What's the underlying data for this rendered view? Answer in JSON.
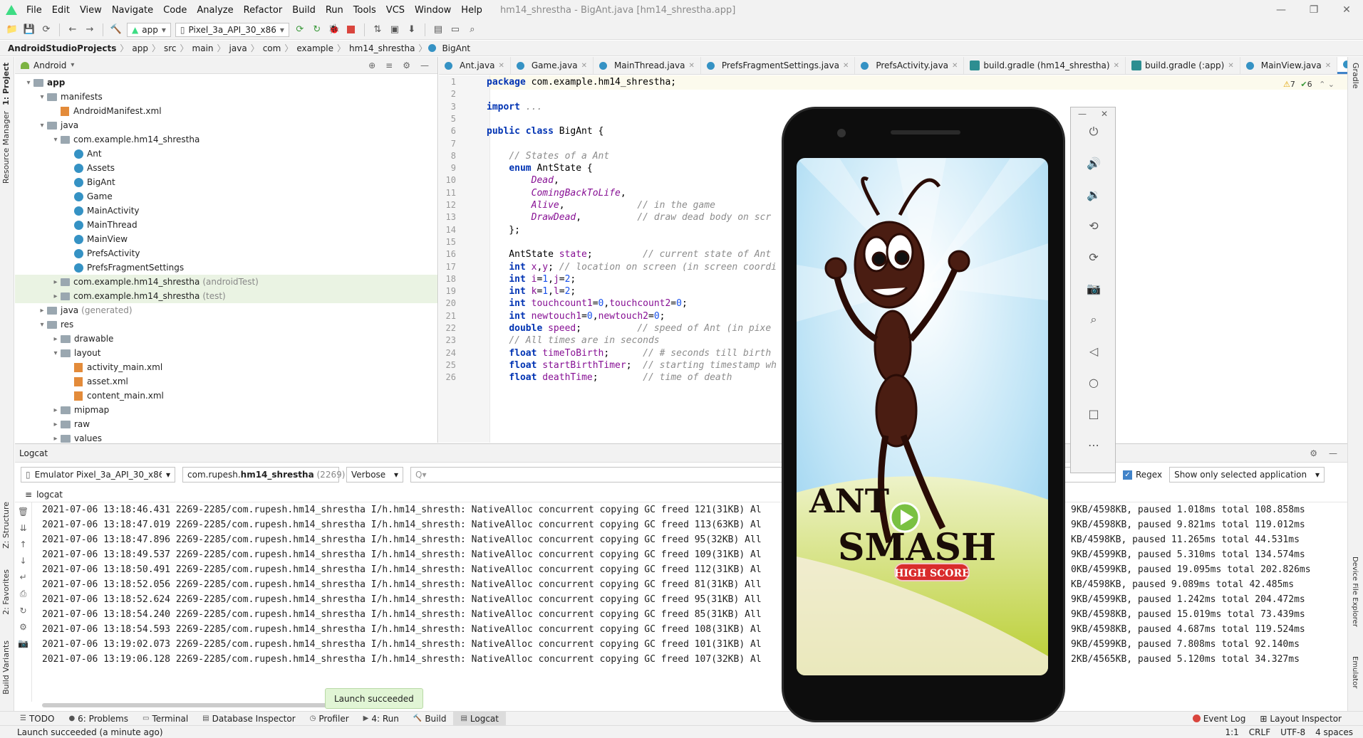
{
  "window": {
    "title": "hm14_shrestha - BigAnt.java [hm14_shrestha.app]"
  },
  "menu": [
    "File",
    "Edit",
    "View",
    "Navigate",
    "Code",
    "Analyze",
    "Refactor",
    "Build",
    "Run",
    "Tools",
    "VCS",
    "Window",
    "Help"
  ],
  "toolbar": {
    "module": "app",
    "device": "Pixel_3a_API_30_x86"
  },
  "breadcrumb": [
    "AndroidStudioProjects",
    "app",
    "src",
    "main",
    "java",
    "com",
    "example",
    "hm14_shrestha",
    "BigAnt"
  ],
  "left_strip": {
    "project": "1: Project",
    "resource_manager": "Resource Manager",
    "structure": "Z: Structure",
    "favorites": "2: Favorites",
    "build_variants": "Build Variants"
  },
  "right_strip": {
    "gradle": "Gradle",
    "device_file_explorer": "Device File Explorer",
    "emulator": "Emulator"
  },
  "project": {
    "view_mode": "Android",
    "tree": [
      {
        "label": "app",
        "suffix": "",
        "kind": "folder",
        "indent": 0,
        "arrow": "▾",
        "bold": true
      },
      {
        "label": "manifests",
        "suffix": "",
        "kind": "folder",
        "indent": 1,
        "arrow": "▾"
      },
      {
        "label": "AndroidManifest.xml",
        "suffix": "",
        "kind": "xml",
        "indent": 2,
        "arrow": ""
      },
      {
        "label": "java",
        "suffix": "",
        "kind": "folder",
        "indent": 1,
        "arrow": "▾"
      },
      {
        "label": "com.example.hm14_shrestha",
        "suffix": "",
        "kind": "pkg",
        "indent": 2,
        "arrow": "▾"
      },
      {
        "label": "Ant",
        "suffix": "",
        "kind": "cls",
        "indent": 3,
        "arrow": ""
      },
      {
        "label": "Assets",
        "suffix": "",
        "kind": "cls",
        "indent": 3,
        "arrow": ""
      },
      {
        "label": "BigAnt",
        "suffix": "",
        "kind": "cls",
        "indent": 3,
        "arrow": ""
      },
      {
        "label": "Game",
        "suffix": "",
        "kind": "cls",
        "indent": 3,
        "arrow": ""
      },
      {
        "label": "MainActivity",
        "suffix": "",
        "kind": "cls",
        "indent": 3,
        "arrow": ""
      },
      {
        "label": "MainThread",
        "suffix": "",
        "kind": "cls",
        "indent": 3,
        "arrow": ""
      },
      {
        "label": "MainView",
        "suffix": "",
        "kind": "cls",
        "indent": 3,
        "arrow": ""
      },
      {
        "label": "PrefsActivity",
        "suffix": "",
        "kind": "cls",
        "indent": 3,
        "arrow": ""
      },
      {
        "label": "PrefsFragmentSettings",
        "suffix": "",
        "kind": "cls",
        "indent": 3,
        "arrow": ""
      },
      {
        "label": "com.example.hm14_shrestha",
        "suffix": "(androidTest)",
        "kind": "pkg",
        "indent": 2,
        "arrow": "▸",
        "hl": true
      },
      {
        "label": "com.example.hm14_shrestha",
        "suffix": "(test)",
        "kind": "pkg",
        "indent": 2,
        "arrow": "▸",
        "hl": true
      },
      {
        "label": "java",
        "suffix": "(generated)",
        "kind": "folder",
        "indent": 1,
        "arrow": "▸"
      },
      {
        "label": "res",
        "suffix": "",
        "kind": "folder",
        "indent": 1,
        "arrow": "▾"
      },
      {
        "label": "drawable",
        "suffix": "",
        "kind": "folder",
        "indent": 2,
        "arrow": "▸"
      },
      {
        "label": "layout",
        "suffix": "",
        "kind": "folder",
        "indent": 2,
        "arrow": "▾"
      },
      {
        "label": "activity_main.xml",
        "suffix": "",
        "kind": "xml",
        "indent": 3,
        "arrow": ""
      },
      {
        "label": "asset.xml",
        "suffix": "",
        "kind": "xml",
        "indent": 3,
        "arrow": ""
      },
      {
        "label": "content_main.xml",
        "suffix": "",
        "kind": "xml",
        "indent": 3,
        "arrow": ""
      },
      {
        "label": "mipmap",
        "suffix": "",
        "kind": "folder",
        "indent": 2,
        "arrow": "▸"
      },
      {
        "label": "raw",
        "suffix": "",
        "kind": "folder",
        "indent": 2,
        "arrow": "▸"
      },
      {
        "label": "values",
        "suffix": "",
        "kind": "folder",
        "indent": 2,
        "arrow": "▸"
      }
    ]
  },
  "editor_tabs": [
    {
      "label": "Ant.java",
      "active": false
    },
    {
      "label": "Game.java",
      "active": false
    },
    {
      "label": "MainThread.java",
      "active": false
    },
    {
      "label": "PrefsFragmentSettings.java",
      "active": false
    },
    {
      "label": "PrefsActivity.java",
      "active": false
    },
    {
      "label": "build.gradle (hm14_shrestha)",
      "active": false
    },
    {
      "label": "build.gradle (:app)",
      "active": false
    },
    {
      "label": "MainView.java",
      "active": false
    },
    {
      "label": "BigAnt.java",
      "active": true
    }
  ],
  "inspections": {
    "warnings": "7",
    "ok": "6"
  },
  "code": [
    {
      "n": "1",
      "html": "<span class=\"kw\">package</span> com.example.hm14_shrestha;"
    },
    {
      "n": "2",
      "html": ""
    },
    {
      "n": "3",
      "html": "<span class=\"kw\">import</span> <span class=\"cm\">...</span>"
    },
    {
      "n": "5",
      "html": ""
    },
    {
      "n": "6",
      "html": "<span class=\"kw\">public class</span> BigAnt {"
    },
    {
      "n": "7",
      "html": ""
    },
    {
      "n": "8",
      "html": "    <span class=\"cm\">// States of a Ant</span>"
    },
    {
      "n": "9",
      "html": "    <span class=\"kw\">enum</span> AntState {"
    },
    {
      "n": "10",
      "html": "        <span class=\"it\">Dead</span>,"
    },
    {
      "n": "11",
      "html": "        <span class=\"it\">ComingBackToLife</span>,"
    },
    {
      "n": "12",
      "html": "        <span class=\"it\">Alive</span>,             <span class=\"cm\">// in the game</span>"
    },
    {
      "n": "13",
      "html": "        <span class=\"it\">DrawDead</span>,          <span class=\"cm\">// draw dead body on scr</span>"
    },
    {
      "n": "14",
      "html": "    };"
    },
    {
      "n": "15",
      "html": ""
    },
    {
      "n": "16",
      "html": "    AntState <span class=\"fld\">state</span>;         <span class=\"cm\">// current state of Ant</span>"
    },
    {
      "n": "17",
      "html": "    <span class=\"kw\">int</span> <span class=\"fld\">x</span>,<span class=\"fld\">y</span>; <span class=\"cm\">// location on screen (in screen coordi</span>"
    },
    {
      "n": "18",
      "html": "    <span class=\"kw\">int</span> <span class=\"fld\">i</span>=<span class=\"num\">1</span>,<span class=\"fld\">j</span>=<span class=\"num\">2</span>;"
    },
    {
      "n": "19",
      "html": "    <span class=\"kw\">int</span> <span class=\"fld\">k</span>=<span class=\"num\">1</span>,<span class=\"fld\">l</span>=<span class=\"num\">2</span>;"
    },
    {
      "n": "20",
      "html": "    <span class=\"kw\">int</span> <span class=\"fld\">touchcount1</span>=<span class=\"num\">0</span>,<span class=\"fld\">touchcount2</span>=<span class=\"num\">0</span>;"
    },
    {
      "n": "21",
      "html": "    <span class=\"kw\">int</span> <span class=\"fld\">newtouch1</span>=<span class=\"num\">0</span>,<span class=\"fld\">newtouch2</span>=<span class=\"num\">0</span>;"
    },
    {
      "n": "22",
      "html": "    <span class=\"kw\">double</span> <span class=\"fld\">speed</span>;          <span class=\"cm\">// speed of Ant (in pixe</span>"
    },
    {
      "n": "23",
      "html": "    <span class=\"cm\">// All times are in seconds</span>"
    },
    {
      "n": "24",
      "html": "    <span class=\"kw\">float</span> <span class=\"fld\">timeToBirth</span>;      <span class=\"cm\">// # seconds till birth</span>"
    },
    {
      "n": "25",
      "html": "    <span class=\"kw\">float</span> <span class=\"fld\">startBirthTimer</span>;  <span class=\"cm\">// starting timestamp wh</span>"
    },
    {
      "n": "26",
      "html": "    <span class=\"kw\">float</span> <span class=\"fld\">deathTime</span>;        <span class=\"cm\">// time of death</span>"
    }
  ],
  "logcat": {
    "title": "Logcat",
    "device": "Emulator Pixel_3a_API_30_x86 Ar",
    "process_prefix": "com.rupesh.",
    "process_bold": "hm14_shrestha",
    "process_pid": "(2269)",
    "level": "Verbose",
    "search_placeholder": "Q▾",
    "regex_label": "Regex",
    "filter": "Show only selected application",
    "tab_label": "logcat",
    "lines": [
      "2021-07-06 13:18:46.431 2269-2285/com.rupesh.hm14_shrestha I/h.hm14_shresth: NativeAlloc concurrent copying GC freed 121(31KB) Al",
      "2021-07-06 13:18:47.019 2269-2285/com.rupesh.hm14_shrestha I/h.hm14_shresth: NativeAlloc concurrent copying GC freed 113(63KB) Al",
      "2021-07-06 13:18:47.896 2269-2285/com.rupesh.hm14_shrestha I/h.hm14_shresth: NativeAlloc concurrent copying GC freed 95(32KB) All",
      "2021-07-06 13:18:49.537 2269-2285/com.rupesh.hm14_shrestha I/h.hm14_shresth: NativeAlloc concurrent copying GC freed 109(31KB) Al",
      "2021-07-06 13:18:50.491 2269-2285/com.rupesh.hm14_shrestha I/h.hm14_shresth: NativeAlloc concurrent copying GC freed 112(31KB) Al",
      "2021-07-06 13:18:52.056 2269-2285/com.rupesh.hm14_shrestha I/h.hm14_shresth: NativeAlloc concurrent copying GC freed 81(31KB) All",
      "2021-07-06 13:18:52.624 2269-2285/com.rupesh.hm14_shrestha I/h.hm14_shresth: NativeAlloc concurrent copying GC freed 95(31KB) All",
      "2021-07-06 13:18:54.240 2269-2285/com.rupesh.hm14_shrestha I/h.hm14_shresth: NativeAlloc concurrent copying GC freed 85(31KB) All",
      "2021-07-06 13:18:54.593 2269-2285/com.rupesh.hm14_shrestha I/h.hm14_shresth: NativeAlloc concurrent copying GC freed 108(31KB) Al",
      "2021-07-06 13:19:02.073 2269-2285/com.rupesh.hm14_shrestha I/h.hm14_shresth: NativeAlloc concurrent copying GC freed 101(31KB) Al",
      "2021-07-06 13:19:06.128 2269-2285/com.rupesh.hm14_shrestha I/h.hm14_shresth: NativeAlloc concurrent copying GC freed 107(32KB) Al"
    ],
    "tails": [
      "9KB/4598KB, paused 1.018ms total 108.858ms",
      "9KB/4598KB, paused 9.821ms total 119.012ms",
      "KB/4598KB, paused 11.265ms total 44.531ms",
      "9KB/4599KB, paused 5.310ms total 134.574ms",
      "0KB/4599KB, paused 19.095ms total 202.826ms",
      "KB/4598KB, paused 9.089ms total 42.485ms",
      "9KB/4599KB, paused 1.242ms total 204.472ms",
      "9KB/4598KB, paused 15.019ms total 73.439ms",
      "9KB/4598KB, paused 4.687ms total 119.524ms",
      "9KB/4599KB, paused 7.808ms total 92.140ms",
      "2KB/4565KB, paused 5.120ms total 34.327ms"
    ]
  },
  "toast": "Launch succeeded",
  "bottom_tabs": [
    "TODO",
    "6: Problems",
    "Terminal",
    "Database Inspector",
    "Profiler",
    "4: Run",
    "Build",
    "Logcat"
  ],
  "bottom_right_tabs": [
    "Event Log",
    "Layout Inspector"
  ],
  "status": {
    "message": "Launch succeeded (a minute ago)",
    "position": "1:1",
    "line_ending": "CRLF",
    "encoding": "UTF-8",
    "indent": "4 spaces"
  },
  "game": {
    "title_line1": "ANT",
    "title_line2": "SMASH",
    "button": "HIGH SCORE"
  },
  "emulator_buttons": [
    "power-icon",
    "volume-up-icon",
    "volume-down-icon",
    "rotate-left-icon",
    "rotate-right-icon",
    "camera-icon",
    "zoom-icon",
    "back-icon",
    "home-icon",
    "overview-icon",
    "more-icon"
  ]
}
